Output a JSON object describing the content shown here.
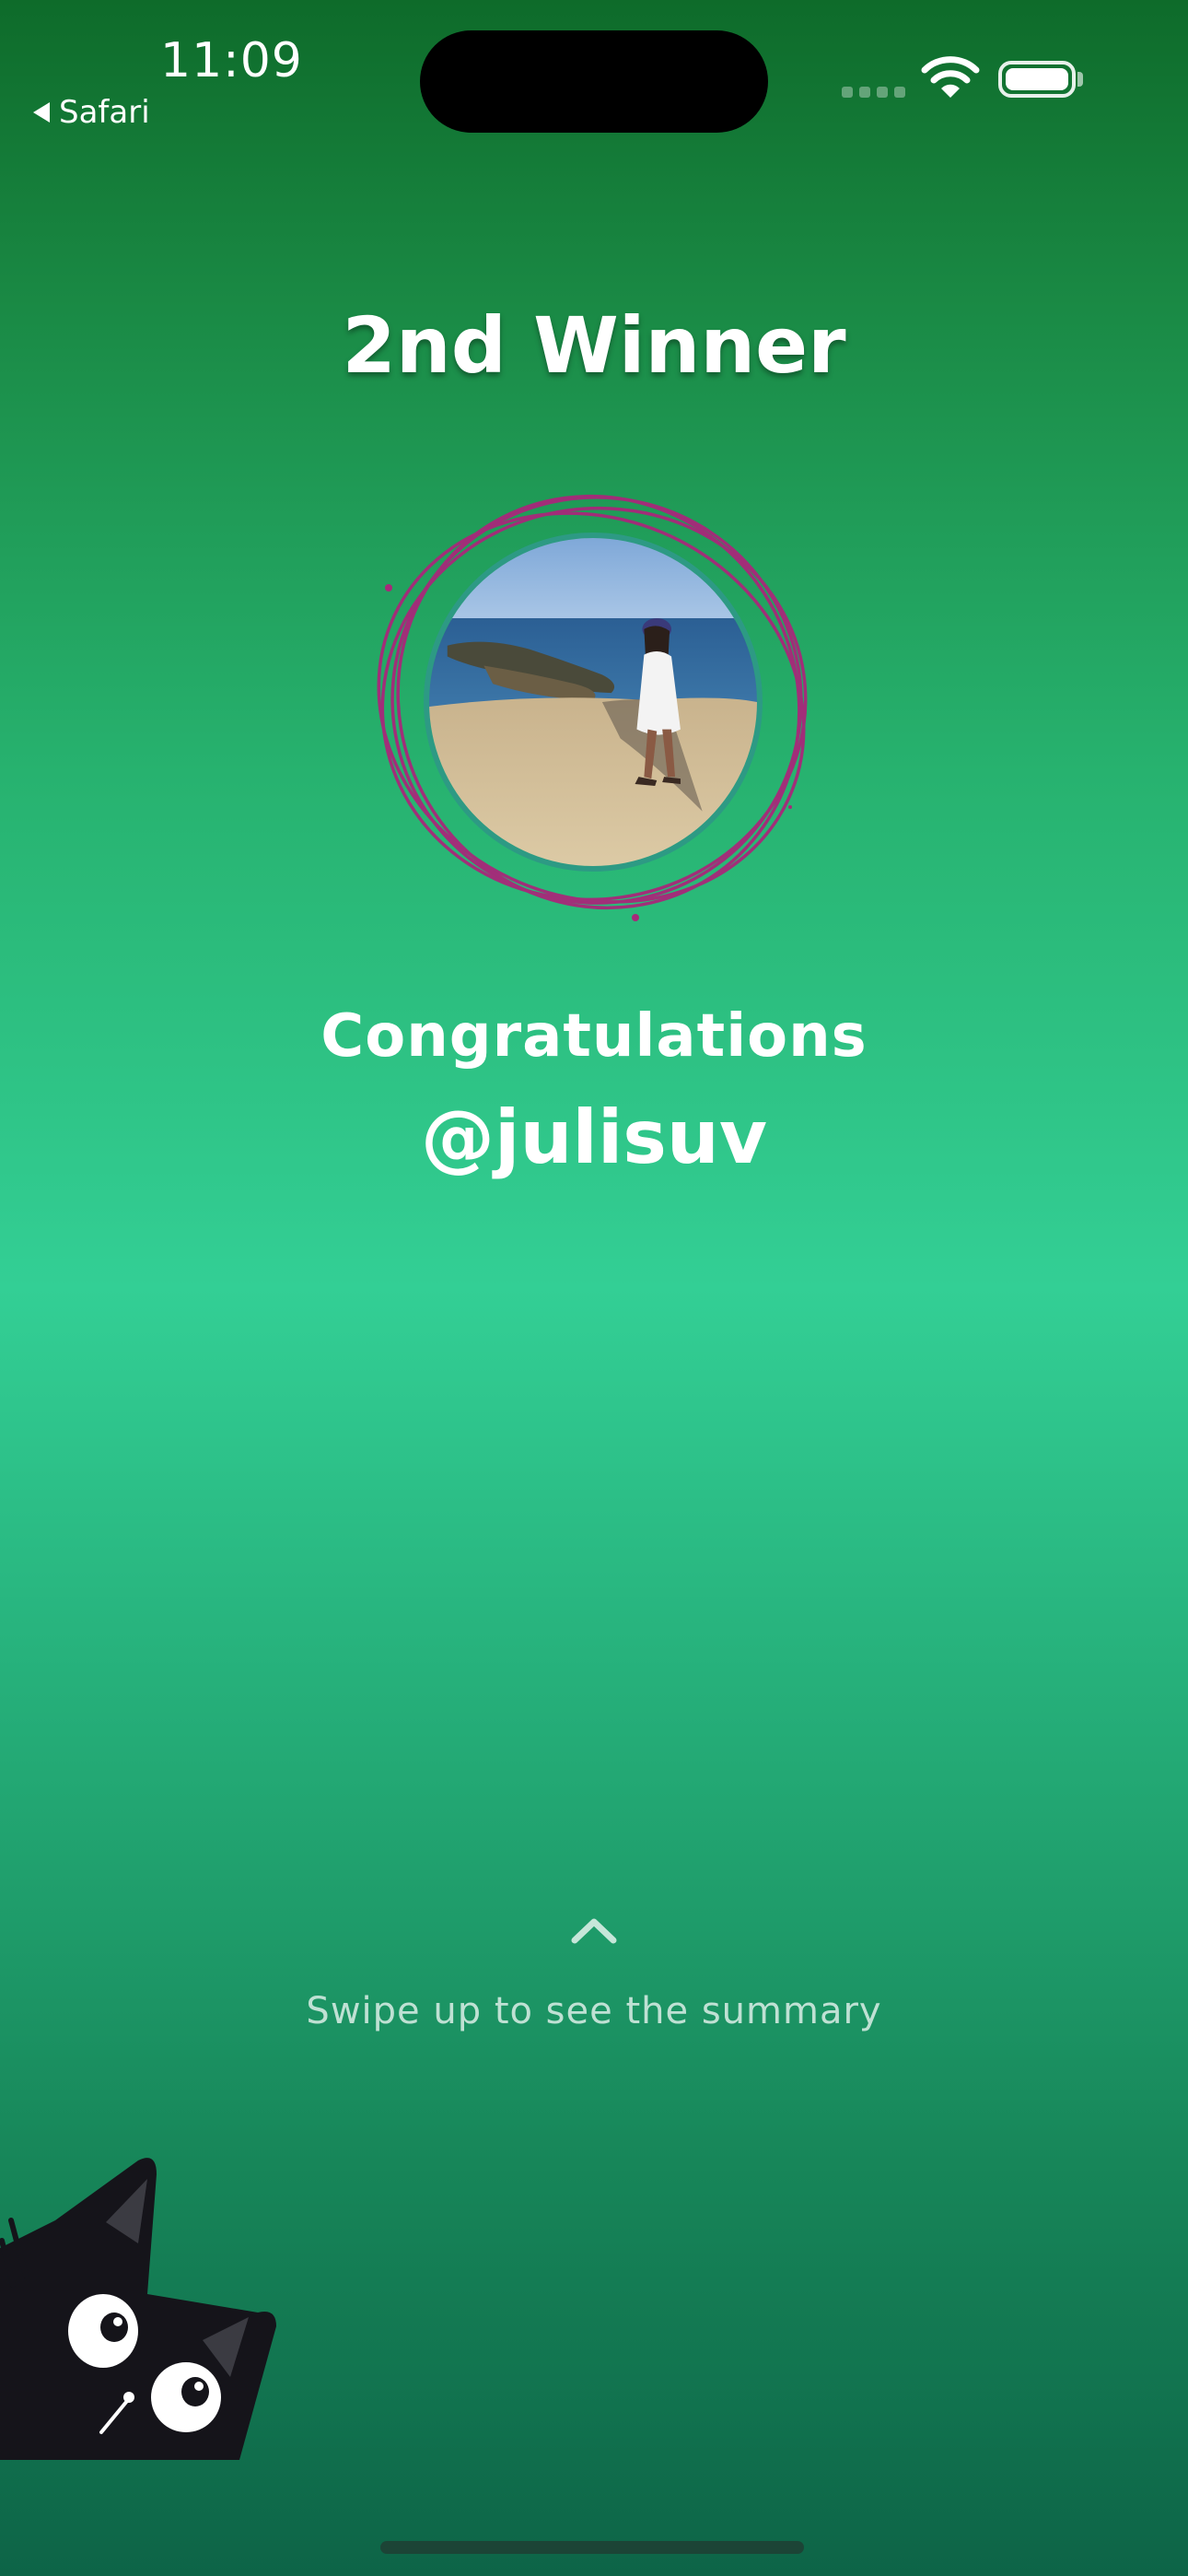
{
  "status_bar": {
    "time": "11:09",
    "back_label": "Safari"
  },
  "icons": {
    "wifi": "wifi-icon",
    "battery": "battery-icon",
    "signal": "cellular-signal-icon",
    "back": "back-arrow-icon",
    "chevron": "chevron-up-icon"
  },
  "main": {
    "title": "2nd Winner",
    "congrats": "Congratulations",
    "username": "@julisuv"
  },
  "footer": {
    "swipe_text": "Swipe up to see the summary"
  },
  "colors": {
    "gradient_top": "#0e6b2a",
    "gradient_mid": "#33cf95",
    "gradient_bottom": "#0d6447",
    "ring": "#b0287a"
  }
}
